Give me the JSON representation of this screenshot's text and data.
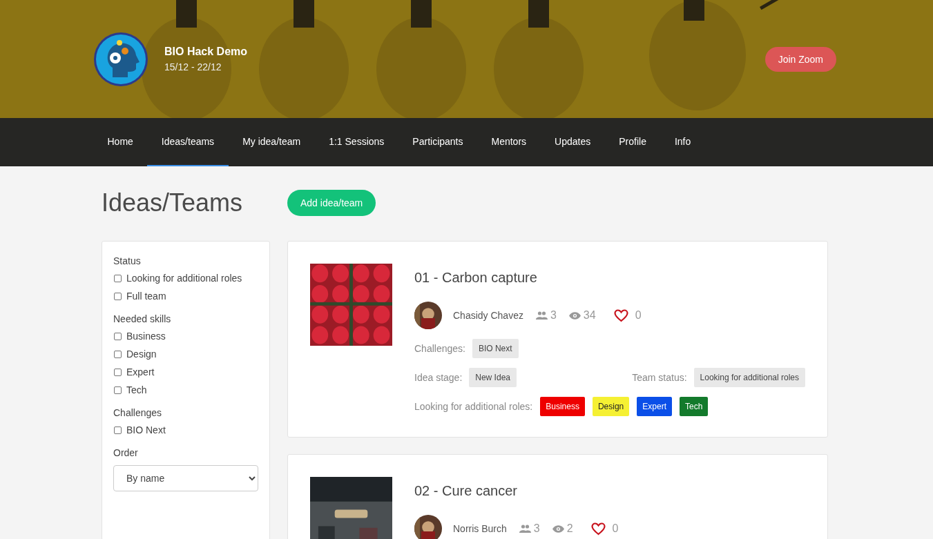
{
  "event": {
    "title": "BIO Hack Demo",
    "dates": "15/12 - 22/12",
    "join_button": "Join Zoom"
  },
  "nav": [
    {
      "label": "Home",
      "selected": false
    },
    {
      "label": "Ideas/teams",
      "selected": true
    },
    {
      "label": "My idea/team",
      "selected": false
    },
    {
      "label": "1:1 Sessions",
      "selected": false
    },
    {
      "label": "Participants",
      "selected": false
    },
    {
      "label": "Mentors",
      "selected": false
    },
    {
      "label": "Updates",
      "selected": false
    },
    {
      "label": "Profile",
      "selected": false
    },
    {
      "label": "Info",
      "selected": false
    }
  ],
  "page": {
    "title": "Ideas/Teams",
    "add_button": "Add idea/team"
  },
  "filters": {
    "groups": [
      {
        "title": "Status",
        "options": [
          {
            "label": "Looking for additional roles",
            "checked": false
          },
          {
            "label": "Full team",
            "checked": false
          }
        ]
      },
      {
        "title": "Needed skills",
        "options": [
          {
            "label": "Business",
            "checked": false
          },
          {
            "label": "Design",
            "checked": false
          },
          {
            "label": "Expert",
            "checked": false
          },
          {
            "label": "Tech",
            "checked": false
          }
        ]
      },
      {
        "title": "Challenges",
        "options": [
          {
            "label": "BIO Next",
            "checked": false
          }
        ]
      }
    ],
    "order": {
      "label": "Order",
      "value": "By name"
    }
  },
  "ideas": [
    {
      "title": "01 - Carbon capture",
      "author": "Chasidy Chavez",
      "members": "3",
      "views": "34",
      "likes": "0",
      "challenges_label": "Challenges:",
      "challenges": [
        "BIO Next"
      ],
      "stage_label": "Idea stage:",
      "stage": "New Idea",
      "status_label": "Team status:",
      "status": "Looking for additional roles",
      "roles_label": "Looking for additional roles:",
      "roles": [
        {
          "label": "Business",
          "color": "#ee0000"
        },
        {
          "label": "Design",
          "color": "#f5f033"
        },
        {
          "label": "Expert",
          "color": "#0b4fe8"
        },
        {
          "label": "Tech",
          "color": "#137a2c"
        }
      ]
    },
    {
      "title": "02 - Cure cancer",
      "author": "Norris Burch",
      "members": "3",
      "views": "2",
      "likes": "0"
    }
  ]
}
